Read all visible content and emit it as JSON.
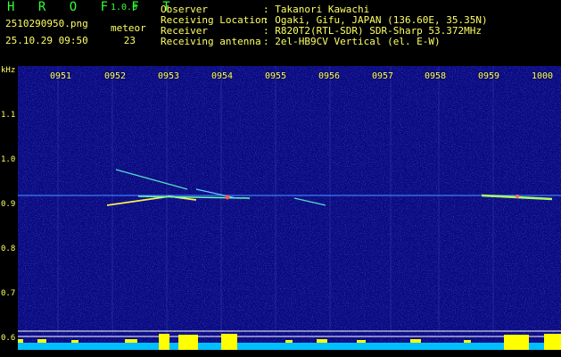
{
  "header": {
    "title": "H R O F F T",
    "version": "1.0.0",
    "file_name": "2510290950.png",
    "date_time": "25.10.29 09:50",
    "meteor_label": "meteor",
    "meteor_count": "23"
  },
  "info": [
    {
      "label": "Observer",
      "value": ": Takanori Kawachi"
    },
    {
      "label": "Receiving Location",
      "value": ": Ogaki, Gifu, JAPAN (136.60E, 35.35N)"
    },
    {
      "label": "Receiver",
      "value": ": R820T2(RTL-SDR) SDR-Sharp 53.372MHz"
    },
    {
      "label": "Receiving antenna",
      "value": ": 2el-HB9CV Vertical (el. E-W)"
    }
  ],
  "axes": {
    "y_unit": "kHz",
    "y_ticks": [
      "1.1",
      "1.0",
      "0.9",
      "0.8",
      "0.7",
      "0.6"
    ],
    "x_ticks": [
      "0951",
      "0952",
      "0953",
      "0954",
      "0955",
      "0956",
      "0957",
      "0958",
      "0959",
      "1000"
    ]
  },
  "colors": {
    "background": "#000000",
    "spectrogram": "#0a0a8a",
    "label_yellow": "#ffff66",
    "title_green": "#33ff33",
    "signal": "#ffff00",
    "baseline": "#00ccff"
  }
}
